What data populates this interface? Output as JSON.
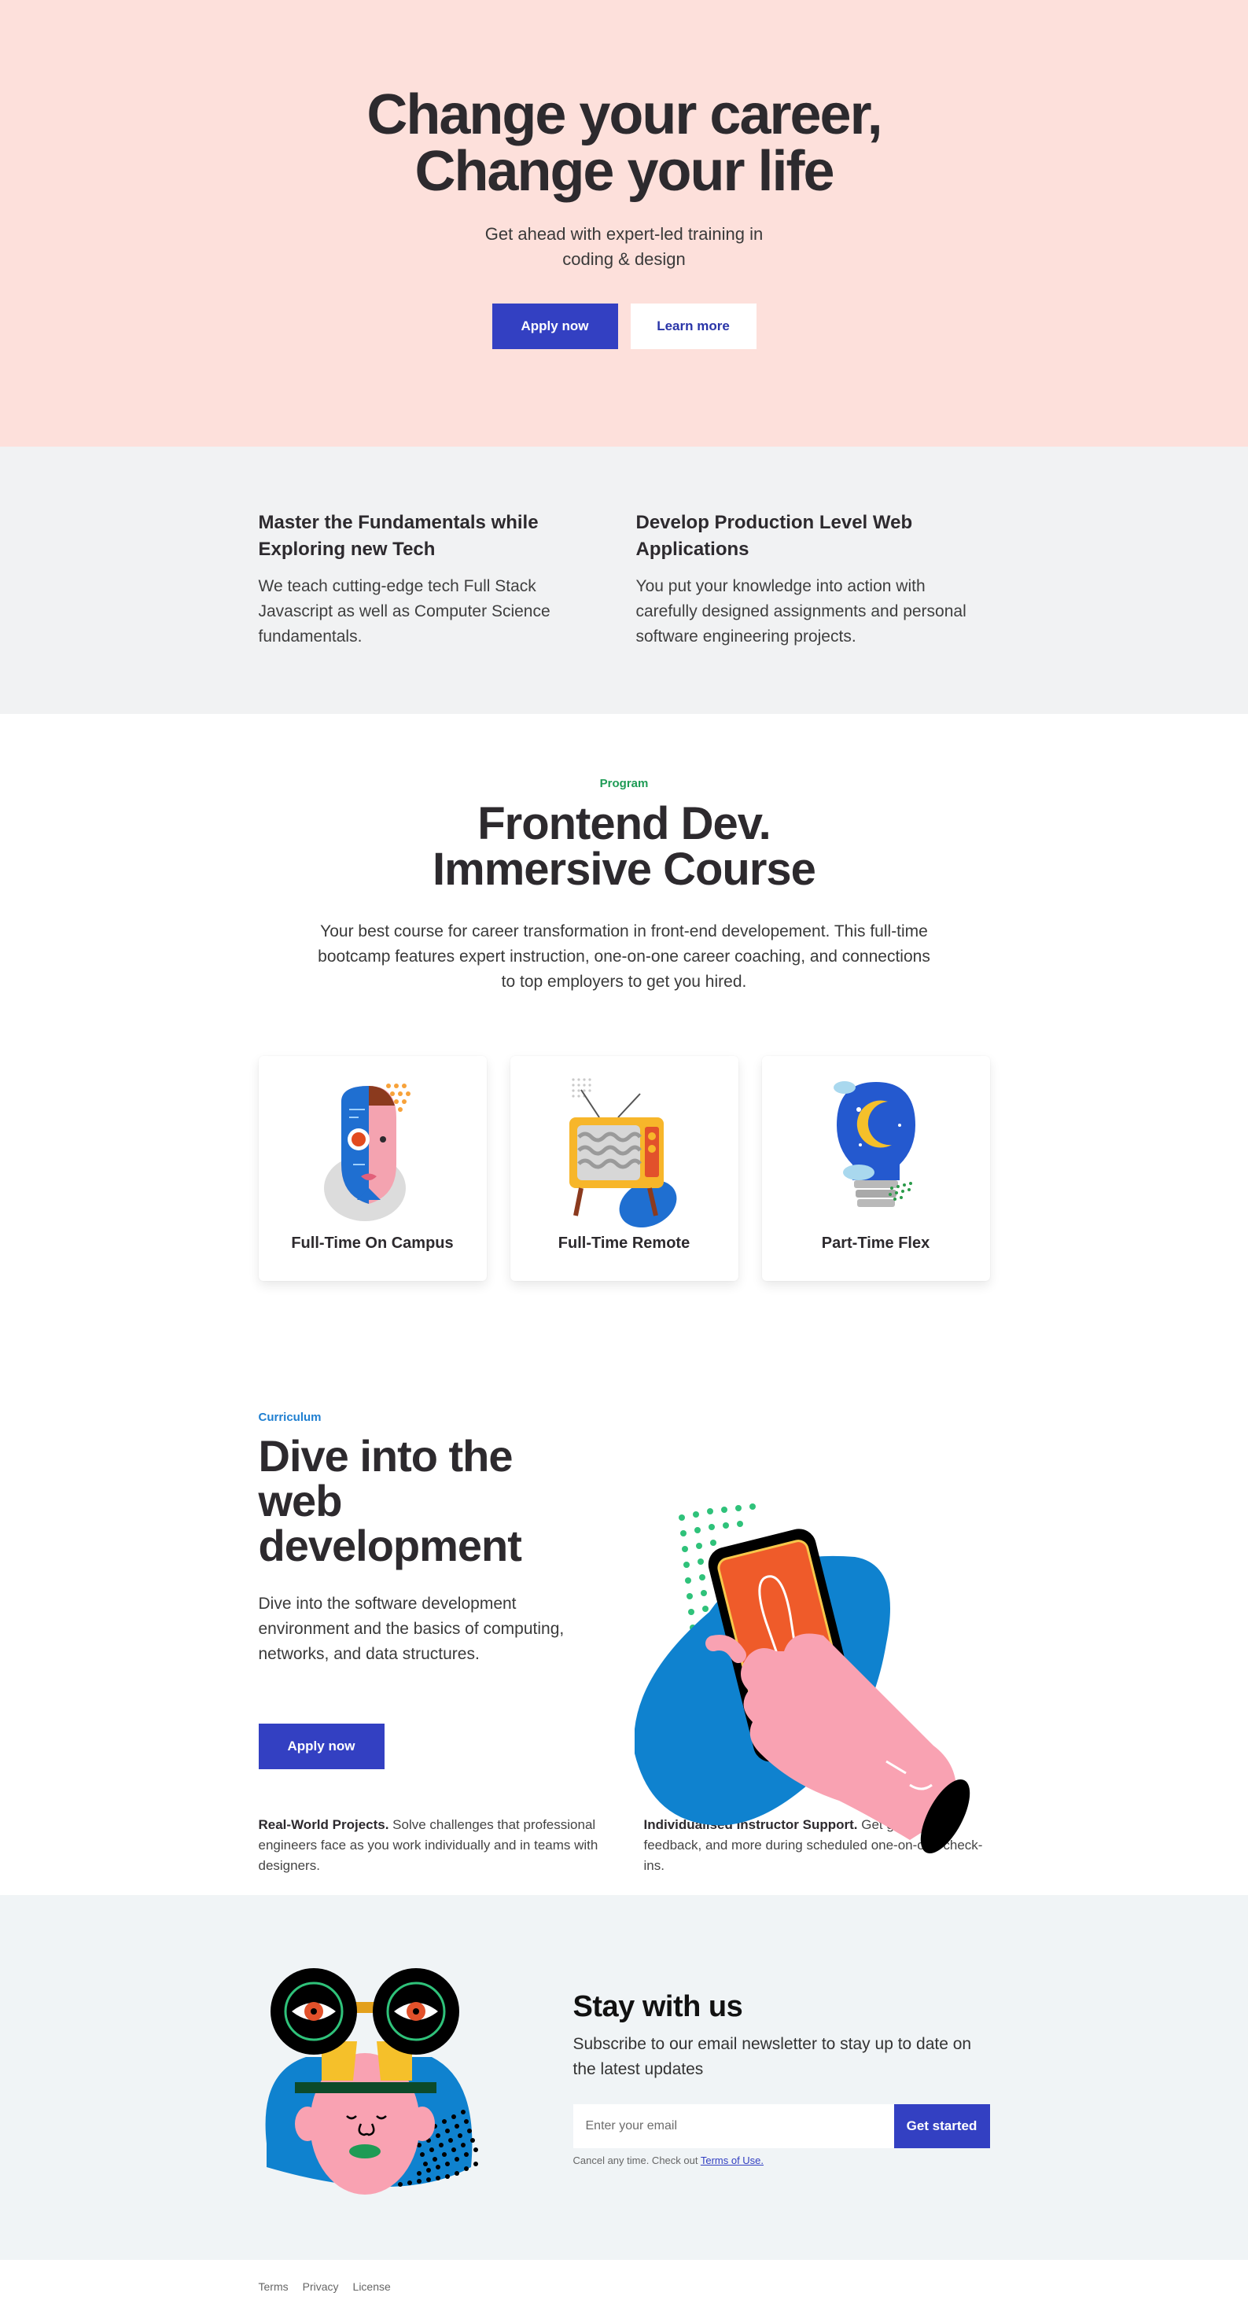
{
  "hero": {
    "title_line1": "Change your career,",
    "title_line2": "Change your life",
    "subtitle": "Get ahead with expert-led training in coding & design",
    "apply_label": "Apply now",
    "learn_label": "Learn more"
  },
  "features": [
    {
      "title": "Master the Fundamentals while Exploring new Tech",
      "text": "We teach cutting-edge tech Full Stack Javascript as well as Computer Science fundamentals."
    },
    {
      "title": "Develop Production Level Web Applications",
      "text": "You put your knowledge into action with carefully designed assignments and personal software engineering projects."
    }
  ],
  "program": {
    "eyebrow": "Program",
    "title_line1": "Frontend Dev.",
    "title_line2": "Immersive Course",
    "description": "Your best course for career transformation in front-end developement. This full-time bootcamp features expert instruction, one-on-one career coaching, and connections to top employers to get you hired.",
    "cards": [
      {
        "label": "Full-Time On Campus",
        "icon": "robot-face-icon"
      },
      {
        "label": "Full-Time Remote",
        "icon": "retro-tv-icon"
      },
      {
        "label": "Part-Time Flex",
        "icon": "moon-lightbulb-icon"
      }
    ]
  },
  "curriculum": {
    "eyebrow": "Curriculum",
    "title_line1": "Dive into the web",
    "title_line2": "development",
    "description": "Dive into the software development environment and the basics of computing, networks, and data structures.",
    "apply_label": "Apply now",
    "notes": [
      {
        "bold": "Real-World Projects.",
        "text": " Solve challenges that professional engineers face as you work individually and in teams with designers."
      },
      {
        "bold": "Individualised Instructor Support.",
        "text": " Get guidance, feedback, and more during scheduled one-on-one check-ins."
      }
    ]
  },
  "newsletter": {
    "title": "Stay with us",
    "subtitle": "Subscribe to our email newsletter to stay up to date on the latest updates",
    "email_placeholder": "Enter your email",
    "cta_label": "Get started",
    "fine_print": "Cancel any time. Check out ",
    "terms_link": "Terms of Use."
  },
  "footer": {
    "links": [
      "Terms",
      "Privacy",
      "License"
    ]
  },
  "colors": {
    "hero_bg": "#fde0db",
    "primary": "#3340c2",
    "features_bg": "#f1f2f3",
    "newsletter_bg": "#f0f4f6",
    "eyebrow_green": "#1e9b55",
    "eyebrow_blue": "#1f7fd1"
  }
}
